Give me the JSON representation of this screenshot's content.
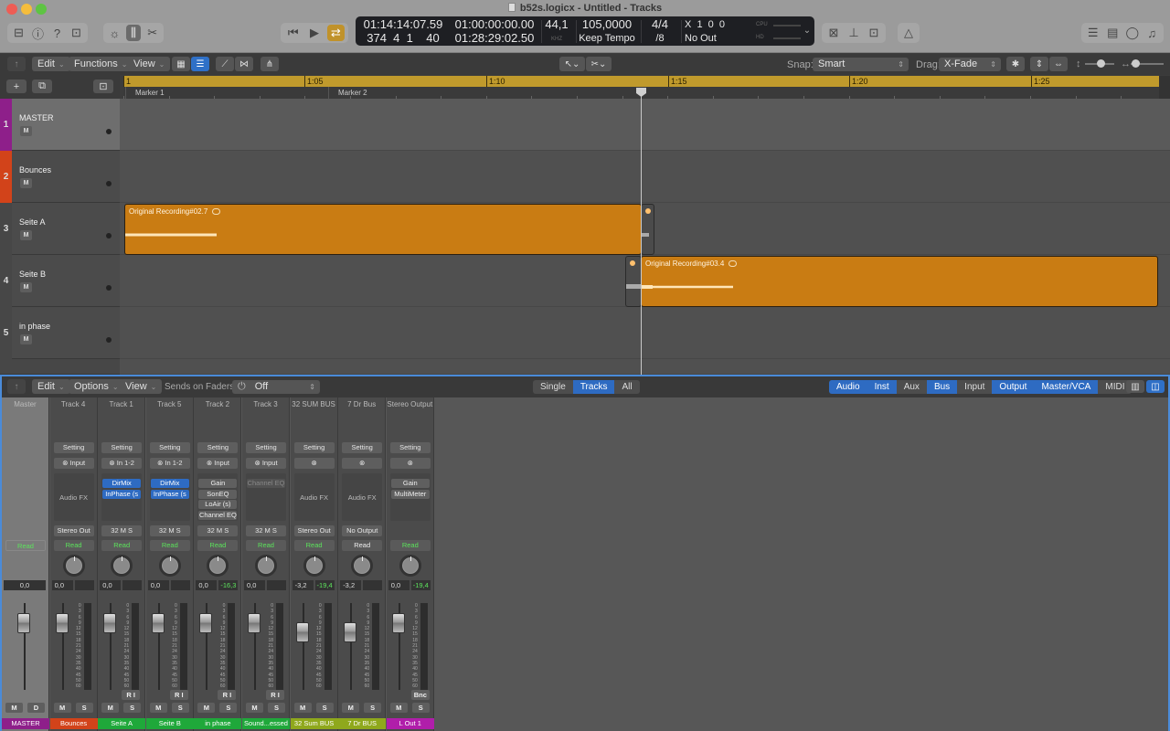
{
  "window": {
    "title": "b52s.logicx - Untitled - Tracks"
  },
  "control_bar": {
    "left_icons": [
      "library-icon",
      "inspector-icon",
      "quick-help-icon",
      "toolbar-icon"
    ],
    "view_icons": [
      "smart-controls-icon",
      "mixer-icon",
      "editors-icon"
    ],
    "transport": [
      "rewind-icon",
      "play-icon",
      "cycle-icon"
    ],
    "lcd": {
      "smpte_position": "01:14:14:07.59",
      "bar_position": "374  4  1    40",
      "cycle_start": "01:00:00:00.00",
      "cycle_end": "01:28:29:02.50",
      "sample_rate": "44,1",
      "sample_rate_unit": "KHZ",
      "tempo": "105,0000",
      "tempo_mode": "Keep Tempo",
      "time_signature": "4/4",
      "division": "/8",
      "key": "X  1  0  0",
      "output": "No Out",
      "cpu_label": "CPU",
      "hd_label": "HD"
    },
    "right_icons": [
      "count-in-icon",
      "tuner-icon",
      "solo-icon",
      "metronome-icon"
    ],
    "far_right_icons": [
      "list-editors-icon",
      "notepad-icon",
      "loop-browser-icon",
      "browsers-icon"
    ]
  },
  "tracks_toolbar": {
    "menus": [
      "Edit",
      "Functions",
      "View"
    ],
    "snap_label": "Snap:",
    "snap_value": "Smart",
    "drag_label": "Drag:",
    "drag_value": "X-Fade"
  },
  "ruler": {
    "ticks": [
      "1",
      "1:05",
      "1:10",
      "1:15",
      "1:20",
      "1:25"
    ],
    "markers": [
      "Marker 1",
      "Marker 2"
    ]
  },
  "tracks": [
    {
      "number": "1",
      "name": "MASTER",
      "color": "#8e1f8a",
      "mute": "M",
      "selected": true
    },
    {
      "number": "2",
      "name": "Bounces",
      "color": "#d2431a",
      "mute": "M",
      "selected": false
    },
    {
      "number": "3",
      "name": "Seite A",
      "color": "",
      "mute": "M",
      "selected": false
    },
    {
      "number": "4",
      "name": "Seite B",
      "color": "",
      "mute": "M",
      "selected": false
    },
    {
      "number": "5",
      "name": "in phase",
      "color": "",
      "mute": "M",
      "selected": false
    }
  ],
  "regions": [
    {
      "name": "Original Recording#02.7",
      "track": 3
    },
    {
      "name": "Original Recording#03.4",
      "track": 4
    }
  ],
  "mixer_toolbar": {
    "menus": [
      "Edit",
      "Options",
      "View"
    ],
    "sends_label": "Sends on Faders:",
    "sends_value": "Off",
    "view_modes": [
      {
        "label": "Single",
        "on": false
      },
      {
        "label": "Tracks",
        "on": true
      },
      {
        "label": "All",
        "on": false
      }
    ],
    "filters": [
      {
        "label": "Audio",
        "on": true
      },
      {
        "label": "Inst",
        "on": true
      },
      {
        "label": "Aux",
        "on": false
      },
      {
        "label": "Bus",
        "on": true
      },
      {
        "label": "Input",
        "on": false
      },
      {
        "label": "Output",
        "on": true
      },
      {
        "label": "Master/VCA",
        "on": true
      },
      {
        "label": "MIDI",
        "on": false
      }
    ]
  },
  "strips": [
    {
      "header": "Master",
      "setting": "",
      "input": "",
      "plugins": [],
      "fx_empty": "",
      "output": "",
      "automation": "Read",
      "auto_green": true,
      "vol": "0,0",
      "peak": "",
      "ri": "",
      "buttons": [
        "M",
        "D"
      ],
      "name": "MASTER",
      "color": "#8e1f8a",
      "fader": 0.0,
      "master": true
    },
    {
      "header": "Track 4",
      "setting": "Setting",
      "input": "Input",
      "plugins": [],
      "fx_empty": "Audio FX",
      "output": "Stereo Out",
      "automation": "Read",
      "auto_green": true,
      "vol": "0,0",
      "peak": "",
      "ri": "",
      "buttons": [
        "M",
        "S"
      ],
      "name": "Bounces",
      "color": "#d2431a",
      "fader": 0.0
    },
    {
      "header": "Track 1",
      "setting": "Setting",
      "input": "In 1-2",
      "plugins": [
        {
          "n": "DirMix",
          "t": "blue"
        },
        {
          "n": "InPhase (s",
          "t": "blue"
        }
      ],
      "fx_empty": "",
      "output": "32 M S",
      "automation": "Read",
      "auto_green": true,
      "vol": "0,0",
      "peak": "",
      "ri": "R I",
      "buttons": [
        "M",
        "S"
      ],
      "name": "Seite A",
      "color": "#1fa83a",
      "fader": 0.0
    },
    {
      "header": "Track 5",
      "setting": "Setting",
      "input": "In 1-2",
      "plugins": [
        {
          "n": "DirMix",
          "t": "blue"
        },
        {
          "n": "InPhase (s",
          "t": "blue"
        }
      ],
      "fx_empty": "",
      "output": "32 M S",
      "automation": "Read",
      "auto_green": true,
      "vol": "0,0",
      "peak": "",
      "ri": "R I",
      "buttons": [
        "M",
        "S"
      ],
      "name": "Seite B",
      "color": "#1fa83a",
      "fader": 0.0
    },
    {
      "header": "Track 2",
      "setting": "Setting",
      "input": "Input",
      "plugins": [
        {
          "n": "Gain",
          "t": ""
        },
        {
          "n": "SonEQ",
          "t": ""
        },
        {
          "n": "LoAir (s)",
          "t": ""
        },
        {
          "n": "Channel EQ",
          "t": ""
        }
      ],
      "fx_empty": "",
      "output": "32 M S",
      "automation": "Read",
      "auto_green": true,
      "vol": "0,0",
      "peak": "-16,3",
      "ri": "R I",
      "buttons": [
        "M",
        "S"
      ],
      "name": "in phase",
      "color": "#1fa83a",
      "fader": 0.0
    },
    {
      "header": "Track 3",
      "setting": "Setting",
      "input": "Input",
      "plugins": [
        {
          "n": "Channel EQ",
          "t": "dim"
        }
      ],
      "fx_empty": "",
      "output": "32 M S",
      "automation": "Read",
      "auto_green": true,
      "vol": "0,0",
      "peak": "",
      "ri": "R I",
      "buttons": [
        "M",
        "S"
      ],
      "name": "Sound...essed",
      "color": "#1fa83a",
      "fader": 0.0
    },
    {
      "header": "32 SUM BUS",
      "setting": "Setting",
      "input": "",
      "plugins": [],
      "fx_empty": "Audio FX",
      "output": "Stereo Out",
      "automation": "Read",
      "auto_green": true,
      "vol": "-3,2",
      "peak": "-19,4",
      "ri": "",
      "buttons": [
        "M",
        "S"
      ],
      "name": "32 Sum BUS",
      "color": "#8fa81c",
      "fader": -3.2
    },
    {
      "header": "7 Dr Bus",
      "setting": "Setting",
      "input": "",
      "plugins": [],
      "fx_empty": "Audio FX",
      "output": "No Output",
      "automation": "Read",
      "auto_green": false,
      "vol": "-3,2",
      "peak": "",
      "ri": "",
      "buttons": [
        "M",
        "S"
      ],
      "name": "7 Dr BUS",
      "color": "#8fa81c",
      "fader": -3.2
    },
    {
      "header": "Stereo Output",
      "setting": "Setting",
      "input": "",
      "plugins": [
        {
          "n": "Gain",
          "t": ""
        },
        {
          "n": "MultiMeter",
          "t": ""
        }
      ],
      "fx_empty": "",
      "output": "",
      "automation": "Read",
      "auto_green": true,
      "vol": "0,0",
      "peak": "-19,4",
      "ri": "Bnc",
      "buttons": [
        "M",
        "S"
      ],
      "name": "L Out 1",
      "color": "#b01eaa",
      "fader": 0.0
    }
  ],
  "fader_scale": [
    "0",
    "3",
    "6",
    "9",
    "12",
    "15",
    "18",
    "21",
    "24",
    "30",
    "35",
    "40",
    "45",
    "50",
    "60"
  ]
}
